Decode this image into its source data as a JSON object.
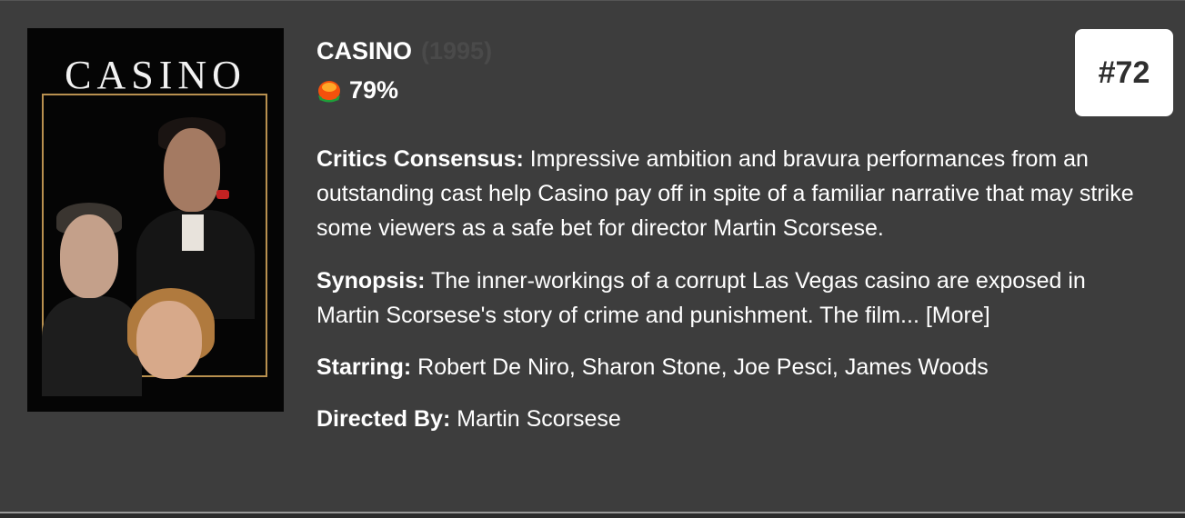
{
  "movie": {
    "title": "CASINO",
    "year": "(1995)",
    "score": "79%",
    "rank": "#72",
    "poster": {
      "title": "CASINO"
    },
    "consensus": {
      "label": "Critics Consensus:",
      "text": "Impressive ambition and bravura performances from an outstanding cast help Casino pay off in spite of a familiar narrative that may strike some viewers as a safe bet for director Martin Scorsese."
    },
    "synopsis": {
      "label": "Synopsis:",
      "text": "The inner-workings of a corrupt Las Vegas casino are exposed in Martin Scorsese's story of crime and punishment. The film...",
      "more": "[More]"
    },
    "starring": {
      "label": "Starring:",
      "text": "Robert De Niro, Sharon Stone, Joe Pesci, James Woods"
    },
    "directed": {
      "label": "Directed By:",
      "text": "Martin Scorsese"
    }
  },
  "icons": {
    "score": "tomatometer-fresh-icon"
  },
  "colors": {
    "background": "#3d3d3d",
    "text": "#ffffff",
    "year": "#4a4a4a",
    "badge_bg": "#ffffff",
    "badge_text": "#2f2f2f",
    "poster_frame": "#b8904f"
  }
}
